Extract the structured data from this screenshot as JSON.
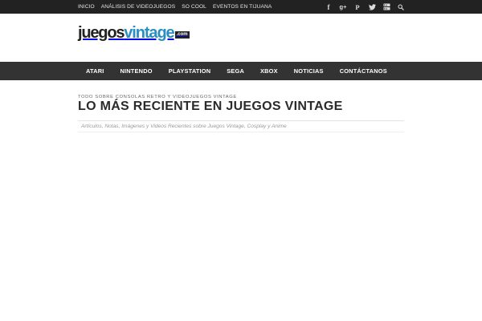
{
  "topnav": {
    "items": [
      "INICIO",
      "ANÁLISIS DE VIDEOJUEGOS",
      "SO COOL",
      "EVENTOS EN TIJUANA"
    ]
  },
  "social": {
    "icons": [
      "facebook-icon",
      "google-plus-icon",
      "pinterest-icon",
      "twitter-icon",
      "youtube-icon",
      "search-icon"
    ]
  },
  "logo": {
    "word1": "juegos",
    "word2": "vintage",
    "tld": ".com"
  },
  "mainnav": {
    "items": [
      "ATARI",
      "NINTENDO",
      "PLAYSTATION",
      "SEGA",
      "XBOX",
      "NOTICIAS",
      "CONTÁCTANOS"
    ]
  },
  "page": {
    "kicker": "TODO SOBRE CONSOLAS RETRO Y VIDEOJUEGOS VINTAGE",
    "title": "LO MÁS RECIENTE EN JUEGOS VINTAGE",
    "subtitle": "Artículos, Notas, Imágenes y Videos Recientes sobre Juegos Vintage, Cosplay y Anime"
  },
  "colors": {
    "topbar": "#222222",
    "nav": "#333333",
    "brand_blue": "#2a8fc0"
  }
}
